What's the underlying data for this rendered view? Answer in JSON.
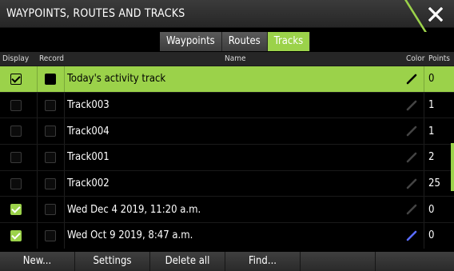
{
  "window": {
    "title": "WAYPOINTS, ROUTES AND TRACKS",
    "close_icon": "close-icon",
    "accent": "#9bd24a"
  },
  "tabs": [
    {
      "label": "Waypoints",
      "active": false
    },
    {
      "label": "Routes",
      "active": false
    },
    {
      "label": "Tracks",
      "active": true
    }
  ],
  "table": {
    "headers": {
      "display": "Display",
      "record": "Record",
      "name": "Name",
      "color": "Color",
      "points": "Points"
    },
    "rows": [
      {
        "display": true,
        "record": true,
        "name": "Today's activity track",
        "color": "#000000",
        "points": "0",
        "selected": true
      },
      {
        "display": false,
        "record": false,
        "name": "Track003",
        "color": "#444444",
        "points": "1"
      },
      {
        "display": false,
        "record": false,
        "name": "Track004",
        "color": "#444444",
        "points": "1"
      },
      {
        "display": false,
        "record": false,
        "name": "Track001",
        "color": "#444444",
        "points": "2"
      },
      {
        "display": false,
        "record": false,
        "name": "Track002",
        "color": "#444444",
        "points": "25"
      },
      {
        "display": true,
        "record": false,
        "name": "Wed Dec 4 2019, 11:20 a.m.",
        "color": "#444444",
        "points": "0"
      },
      {
        "display": true,
        "record": false,
        "name": "Wed Oct 9 2019, 8:47 a.m.",
        "color": "#5a6cff",
        "points": "0"
      }
    ]
  },
  "bottom_buttons": {
    "new": "New...",
    "settings": "Settings",
    "delete_all": "Delete all",
    "find": "Find..."
  }
}
